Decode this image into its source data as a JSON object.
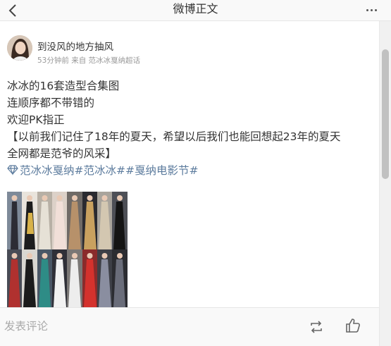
{
  "header": {
    "title": "微博正文"
  },
  "author": {
    "name": "到没风的地方抽风",
    "meta": "53分钟前 来自 范冰冰戛纳超话"
  },
  "post": {
    "line1": "冰冰的16套造型合集图",
    "line2": "连顺序都不带错的",
    "line3": "欢迎PK指正",
    "line4": "【以前我们记住了18年的夏天，希望以后我们也能回想起23年的夏天",
    "line5": "全网都是范爷的风采】",
    "topic1": "范冰冰戛纳",
    "topic2": "#范冰冰#",
    "topic3": "#戛纳电影节#"
  },
  "footer": {
    "comment_placeholder": "发表评论"
  },
  "colors": {
    "link": "#5d7c9e",
    "header_bg": "#f9f9f9"
  }
}
